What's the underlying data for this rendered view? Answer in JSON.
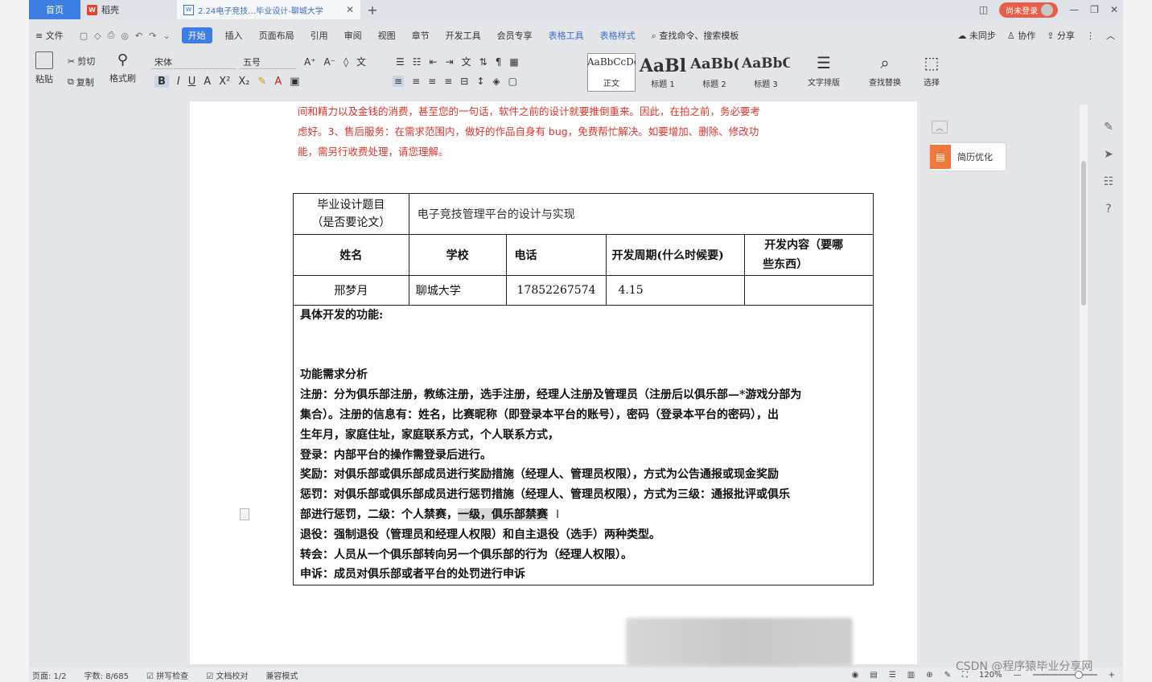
{
  "tabs": {
    "home": "首页",
    "daoke": "稻壳",
    "doc_title": "2.24电子竞技…毕业设计-聊城大学"
  },
  "titlebar": {
    "login": "尚未登录"
  },
  "menu": {
    "items": [
      "文件",
      "开始",
      "插入",
      "页面布局",
      "引用",
      "审阅",
      "视图",
      "章节",
      "开发工具",
      "会员专享",
      "表格工具",
      "表格样式"
    ],
    "search": "查找命令、搜索模板",
    "right": [
      "未同步",
      "协作",
      "分享"
    ]
  },
  "ribbon": {
    "paste": "粘贴",
    "cut": "剪切",
    "copy": "复制",
    "format_painter": "格式刷",
    "font_name": "宋体",
    "font_size": "五号",
    "styles": [
      {
        "sample": "AaBbCcDd",
        "name": "正文"
      },
      {
        "sample": "AaBl",
        "name": "标题 1"
      },
      {
        "sample": "AaBb(",
        "name": "标题 2"
      },
      {
        "sample": "AaBbC",
        "name": "标题 3"
      }
    ],
    "text_layout": "文字排版",
    "find_replace": "查找替换",
    "select": "选择"
  },
  "document": {
    "red_text": [
      "间和精力以及金钱的消费，甚至您的一句话，软件之前的设计就要推倒重来。因此，在拍之前，务必要考",
      "虑好。3、售后服务：在需求范围内，做好的作品自身有 bug，免费帮忙解决。如要增加、删除、修改功",
      "能，需另行收费处理，请您理解。"
    ],
    "table": {
      "topic_label_1": "毕业设计题目",
      "topic_label_2": "（是否要论文）",
      "topic_value": "电子竞技管理平台的设计与实现",
      "headers": [
        "姓名",
        "学校",
        "电话",
        "开发周期(什么时候要)"
      ],
      "header_last_1": "开发内容（要哪",
      "header_last_2": "些东西）",
      "row": [
        "邢梦月",
        "聊城大学",
        "17852267574",
        "4.15",
        ""
      ]
    },
    "body_lines": [
      "具体开发的功能:",
      "",
      "",
      "功能需求分析",
      "注册：分为俱乐部注册，教练注册，选手注册，经理人注册及管理员（注册后以俱乐部—*游戏分部为",
      "集合）。注册的信息有：姓名，比赛昵称（即登录本平台的账号），密码（登录本平台的密码），出",
      "生年月，家庭住址，家庭联系方式，个人联系方式，",
      "登录：内部平台的操作需登录后进行。",
      "奖励：对俱乐部或俱乐部成员进行奖励措施（经理人、管理员权限），方式为公告通报或现金奖励",
      "惩罚：对俱乐部或俱乐部成员进行惩罚措施（经理人、管理员权限），方式为三级：通报批评或俱乐",
      "部进行惩罚，二级：个人禁赛，",
      "退役：强制退役（管理员和经理人权限）和自主退役（选手）两种类型。",
      "转会：人员从一个俱乐部转向另一个俱乐部的行为（经理人权限）。",
      "申诉：成员对俱乐部或者平台的处罚进行申诉"
    ],
    "highlighted": "一级，俱乐部禁赛"
  },
  "side_panel": {
    "resume": "简历优化"
  },
  "status": {
    "page": "页面: 1/2",
    "words": "字数: 8/685",
    "spell": "拼写检查",
    "proofread": "文档校对",
    "compat": "兼容模式",
    "zoom": "120%"
  },
  "watermark": "CSDN @程序猿毕业分享网"
}
